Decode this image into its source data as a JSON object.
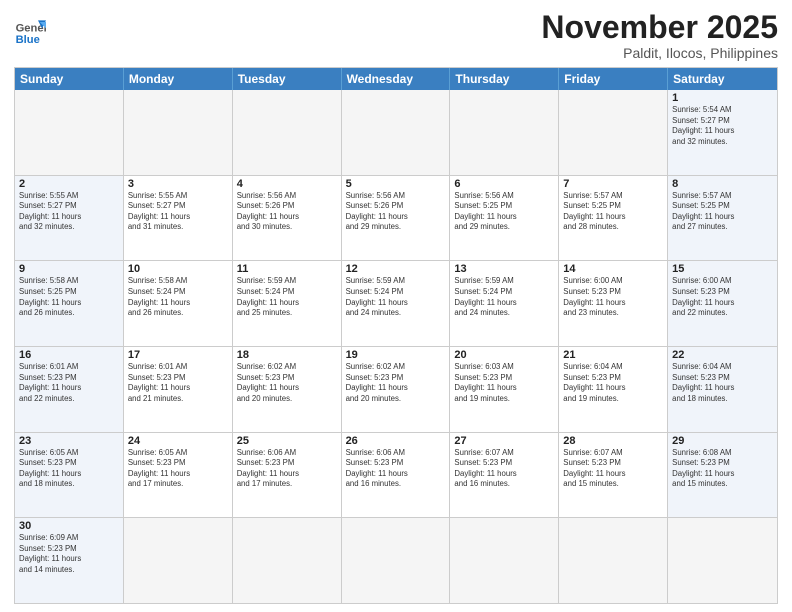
{
  "logo": {
    "general": "General",
    "blue": "Blue"
  },
  "title": "November 2025",
  "location": "Paldit, Ilocos, Philippines",
  "days": [
    "Sunday",
    "Monday",
    "Tuesday",
    "Wednesday",
    "Thursday",
    "Friday",
    "Saturday"
  ],
  "rows": [
    [
      {
        "day": "",
        "info": "",
        "empty": true
      },
      {
        "day": "",
        "info": "",
        "empty": true
      },
      {
        "day": "",
        "info": "",
        "empty": true
      },
      {
        "day": "",
        "info": "",
        "empty": true
      },
      {
        "day": "",
        "info": "",
        "empty": true
      },
      {
        "day": "",
        "info": "",
        "empty": true
      },
      {
        "day": "1",
        "info": "Sunrise: 5:54 AM\nSunset: 5:27 PM\nDaylight: 11 hours\nand 32 minutes.",
        "weekend": true
      }
    ],
    [
      {
        "day": "2",
        "info": "Sunrise: 5:55 AM\nSunset: 5:27 PM\nDaylight: 11 hours\nand 32 minutes.",
        "weekend": true
      },
      {
        "day": "3",
        "info": "Sunrise: 5:55 AM\nSunset: 5:27 PM\nDaylight: 11 hours\nand 31 minutes."
      },
      {
        "day": "4",
        "info": "Sunrise: 5:56 AM\nSunset: 5:26 PM\nDaylight: 11 hours\nand 30 minutes."
      },
      {
        "day": "5",
        "info": "Sunrise: 5:56 AM\nSunset: 5:26 PM\nDaylight: 11 hours\nand 29 minutes."
      },
      {
        "day": "6",
        "info": "Sunrise: 5:56 AM\nSunset: 5:25 PM\nDaylight: 11 hours\nand 29 minutes."
      },
      {
        "day": "7",
        "info": "Sunrise: 5:57 AM\nSunset: 5:25 PM\nDaylight: 11 hours\nand 28 minutes."
      },
      {
        "day": "8",
        "info": "Sunrise: 5:57 AM\nSunset: 5:25 PM\nDaylight: 11 hours\nand 27 minutes.",
        "weekend": true
      }
    ],
    [
      {
        "day": "9",
        "info": "Sunrise: 5:58 AM\nSunset: 5:25 PM\nDaylight: 11 hours\nand 26 minutes.",
        "weekend": true
      },
      {
        "day": "10",
        "info": "Sunrise: 5:58 AM\nSunset: 5:24 PM\nDaylight: 11 hours\nand 26 minutes."
      },
      {
        "day": "11",
        "info": "Sunrise: 5:59 AM\nSunset: 5:24 PM\nDaylight: 11 hours\nand 25 minutes."
      },
      {
        "day": "12",
        "info": "Sunrise: 5:59 AM\nSunset: 5:24 PM\nDaylight: 11 hours\nand 24 minutes."
      },
      {
        "day": "13",
        "info": "Sunrise: 5:59 AM\nSunset: 5:24 PM\nDaylight: 11 hours\nand 24 minutes."
      },
      {
        "day": "14",
        "info": "Sunrise: 6:00 AM\nSunset: 5:23 PM\nDaylight: 11 hours\nand 23 minutes."
      },
      {
        "day": "15",
        "info": "Sunrise: 6:00 AM\nSunset: 5:23 PM\nDaylight: 11 hours\nand 22 minutes.",
        "weekend": true
      }
    ],
    [
      {
        "day": "16",
        "info": "Sunrise: 6:01 AM\nSunset: 5:23 PM\nDaylight: 11 hours\nand 22 minutes.",
        "weekend": true
      },
      {
        "day": "17",
        "info": "Sunrise: 6:01 AM\nSunset: 5:23 PM\nDaylight: 11 hours\nand 21 minutes."
      },
      {
        "day": "18",
        "info": "Sunrise: 6:02 AM\nSunset: 5:23 PM\nDaylight: 11 hours\nand 20 minutes."
      },
      {
        "day": "19",
        "info": "Sunrise: 6:02 AM\nSunset: 5:23 PM\nDaylight: 11 hours\nand 20 minutes."
      },
      {
        "day": "20",
        "info": "Sunrise: 6:03 AM\nSunset: 5:23 PM\nDaylight: 11 hours\nand 19 minutes."
      },
      {
        "day": "21",
        "info": "Sunrise: 6:04 AM\nSunset: 5:23 PM\nDaylight: 11 hours\nand 19 minutes."
      },
      {
        "day": "22",
        "info": "Sunrise: 6:04 AM\nSunset: 5:23 PM\nDaylight: 11 hours\nand 18 minutes.",
        "weekend": true
      }
    ],
    [
      {
        "day": "23",
        "info": "Sunrise: 6:05 AM\nSunset: 5:23 PM\nDaylight: 11 hours\nand 18 minutes.",
        "weekend": true
      },
      {
        "day": "24",
        "info": "Sunrise: 6:05 AM\nSunset: 5:23 PM\nDaylight: 11 hours\nand 17 minutes."
      },
      {
        "day": "25",
        "info": "Sunrise: 6:06 AM\nSunset: 5:23 PM\nDaylight: 11 hours\nand 17 minutes."
      },
      {
        "day": "26",
        "info": "Sunrise: 6:06 AM\nSunset: 5:23 PM\nDaylight: 11 hours\nand 16 minutes."
      },
      {
        "day": "27",
        "info": "Sunrise: 6:07 AM\nSunset: 5:23 PM\nDaylight: 11 hours\nand 16 minutes."
      },
      {
        "day": "28",
        "info": "Sunrise: 6:07 AM\nSunset: 5:23 PM\nDaylight: 11 hours\nand 15 minutes."
      },
      {
        "day": "29",
        "info": "Sunrise: 6:08 AM\nSunset: 5:23 PM\nDaylight: 11 hours\nand 15 minutes.",
        "weekend": true
      }
    ],
    [
      {
        "day": "30",
        "info": "Sunrise: 6:09 AM\nSunset: 5:23 PM\nDaylight: 11 hours\nand 14 minutes.",
        "weekend": true
      },
      {
        "day": "",
        "info": "",
        "empty": true
      },
      {
        "day": "",
        "info": "",
        "empty": true
      },
      {
        "day": "",
        "info": "",
        "empty": true
      },
      {
        "day": "",
        "info": "",
        "empty": true
      },
      {
        "day": "",
        "info": "",
        "empty": true
      },
      {
        "day": "",
        "info": "",
        "empty": true
      }
    ]
  ]
}
